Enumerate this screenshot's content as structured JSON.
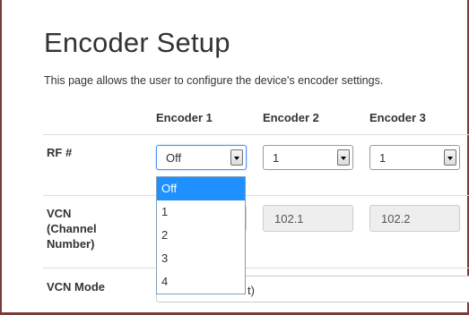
{
  "page": {
    "title": "Encoder Setup",
    "description": "This page allows the user to configure the device's encoder settings."
  },
  "columns": [
    "Encoder 1",
    "Encoder 2",
    "Encoder 3"
  ],
  "rows": {
    "rf": {
      "label": "RF #",
      "values": [
        "Off",
        "1",
        "1"
      ]
    },
    "vcn": {
      "label_line1": "VCN",
      "label_line2": "(Channel",
      "label_line3": "Number)",
      "values": [
        "102.1",
        "102.2"
      ]
    },
    "vcn_mode": {
      "label": "VCN Mode",
      "visible_value_fragment": "t)"
    }
  },
  "dropdown": {
    "options": [
      "Off",
      "1",
      "2",
      "3",
      "4"
    ],
    "selected": "Off"
  },
  "colors": {
    "frame": "#7a3b3b",
    "highlight": "#1e90ff",
    "readonly_bg": "#eeeeee"
  }
}
